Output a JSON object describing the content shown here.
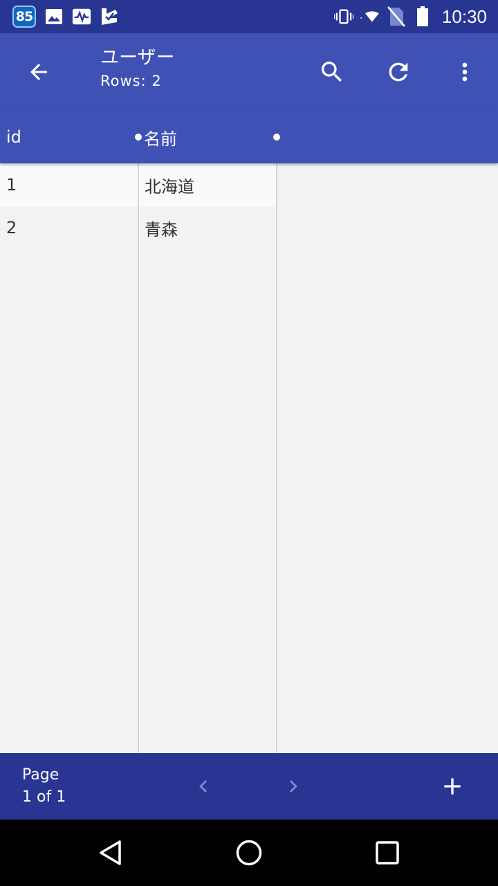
{
  "status_bar": {
    "notification_badge": "85",
    "left_icons": [
      "image-icon",
      "activity-icon",
      "check-icon"
    ],
    "right_icons": [
      "vibrate-icon",
      "wifi-icon",
      "no-sim-icon",
      "battery-icon"
    ],
    "time": "10:30"
  },
  "app_bar": {
    "title": "ユーザー",
    "subtitle": "Rows: 2",
    "actions": [
      "back-arrow-icon",
      "search-icon",
      "refresh-icon",
      "more-vert-icon"
    ]
  },
  "table": {
    "columns": [
      "id",
      "名前"
    ],
    "rows": [
      [
        "1",
        "北海道"
      ],
      [
        "2",
        "青森"
      ]
    ]
  },
  "pagination": {
    "label": "Page",
    "position": "1 of 1"
  },
  "colors": {
    "status_bar": "#283593",
    "app_bar": "#3f51b5",
    "bottom_bar": "#283593",
    "background": "#f2f2f2"
  }
}
